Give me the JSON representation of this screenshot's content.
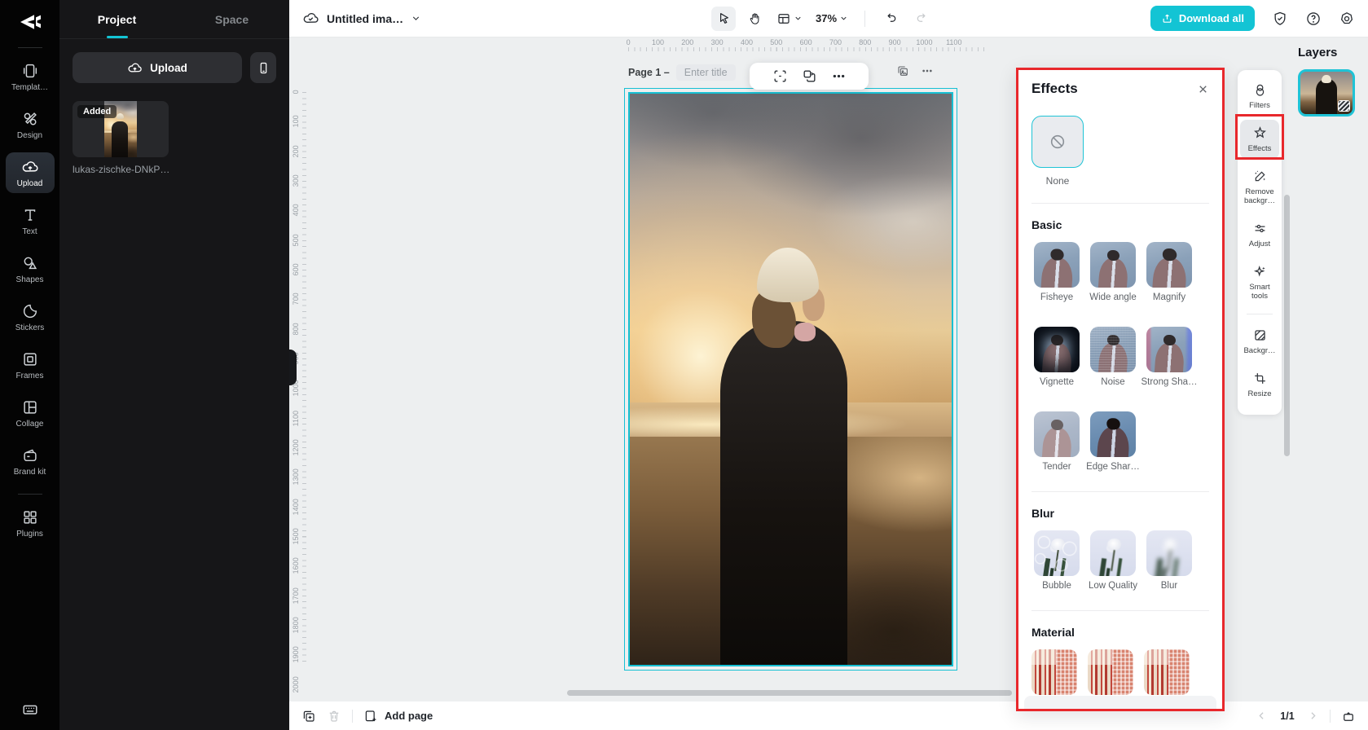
{
  "brand": {
    "accent_teal": "#13c4d4",
    "selection_cyan": "#16c0d3",
    "annotation_red": "#e8282c"
  },
  "left_nav": {
    "items": [
      {
        "label": "Templat…",
        "icon": "templates-icon"
      },
      {
        "label": "Design",
        "icon": "design-icon"
      },
      {
        "label": "Upload",
        "icon": "upload-icon",
        "active": true
      },
      {
        "label": "Text",
        "icon": "text-icon"
      },
      {
        "label": "Shapes",
        "icon": "shapes-icon"
      },
      {
        "label": "Stickers",
        "icon": "stickers-icon"
      },
      {
        "label": "Frames",
        "icon": "frames-icon"
      },
      {
        "label": "Collage",
        "icon": "collage-icon"
      },
      {
        "label": "Brand kit",
        "icon": "brand-kit-icon"
      },
      {
        "label": "Plugins",
        "icon": "plugins-icon"
      }
    ]
  },
  "project_panel": {
    "tabs": [
      {
        "label": "Project",
        "active": true
      },
      {
        "label": "Space"
      }
    ],
    "upload_button": "Upload",
    "added_badge": "Added",
    "file_name": "lukas-zischke-DNkP…"
  },
  "top_bar": {
    "doc_title": "Untitled ima…",
    "zoom_level": "37%",
    "download_button": "Download all"
  },
  "canvas": {
    "page_label": "Page 1 –",
    "title_placeholder": "Enter title",
    "h_ruler": [
      "0",
      "100",
      "200",
      "300",
      "400",
      "500",
      "600",
      "700",
      "800",
      "900",
      "1000",
      "1100"
    ],
    "v_ruler": [
      "0",
      "100",
      "200",
      "300",
      "400",
      "500",
      "600",
      "700",
      "800",
      "900",
      "1000",
      "1100",
      "1200",
      "1300",
      "1400",
      "1500",
      "1600",
      "1700",
      "1800",
      "1900",
      "2000"
    ]
  },
  "effects_panel": {
    "title": "Effects",
    "none_label": "None",
    "sections": {
      "basic": {
        "title": "Basic",
        "items": [
          {
            "label": "Fisheye",
            "variant": "v-fisheye"
          },
          {
            "label": "Wide angle",
            "variant": "v-wide"
          },
          {
            "label": "Magnify",
            "variant": "v-magnify"
          },
          {
            "label": "Vignette",
            "variant": "v-vignette"
          },
          {
            "label": "Noise",
            "variant": "v-noise"
          },
          {
            "label": "Strong Sha…",
            "variant": "v-strong"
          },
          {
            "label": "Tender",
            "variant": "v-tender"
          },
          {
            "label": "Edge Shar…",
            "variant": "v-edge"
          }
        ]
      },
      "blur": {
        "title": "Blur",
        "items": [
          {
            "label": "Bubble",
            "variant": "v-bubble"
          },
          {
            "label": "Low Quality",
            "variant": "v-lowq"
          },
          {
            "label": "Blur",
            "variant": "v-blur"
          }
        ]
      },
      "material": {
        "title": "Material"
      }
    }
  },
  "right_rail": {
    "items": [
      {
        "label": "Filters",
        "icon": "filters-icon"
      },
      {
        "label": "Effects",
        "icon": "effects-icon",
        "active": true
      },
      {
        "label": "Remove backgr…",
        "icon": "remove-background-icon"
      },
      {
        "label": "Adjust",
        "icon": "adjust-icon"
      },
      {
        "label": "Smart tools",
        "icon": "smart-tools-icon"
      },
      {
        "label": "Backgr…",
        "icon": "background-icon"
      },
      {
        "label": "Resize",
        "icon": "resize-icon"
      }
    ]
  },
  "layers_panel": {
    "title": "Layers"
  },
  "bottom_bar": {
    "add_page": "Add page",
    "page_indicator": "1/1"
  }
}
